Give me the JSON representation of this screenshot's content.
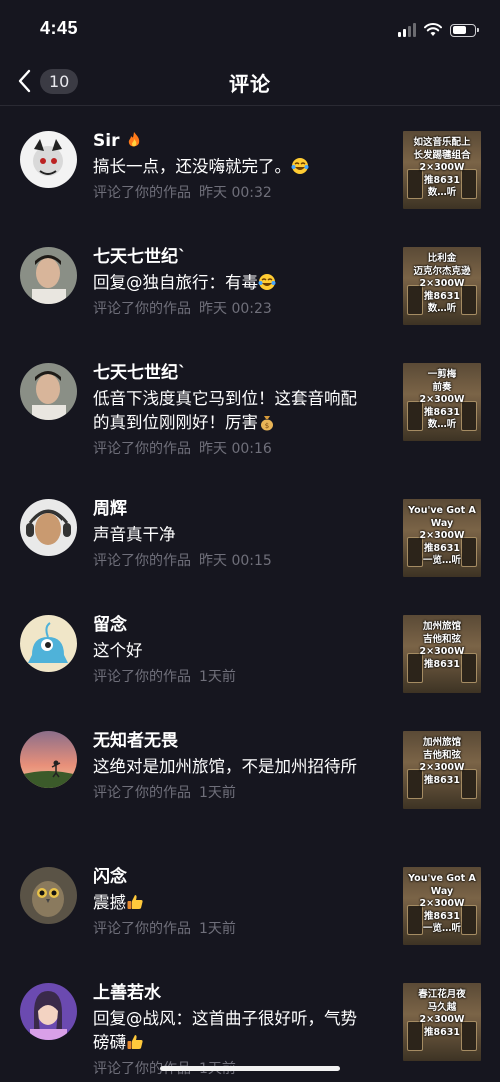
{
  "status": {
    "time": "4:45"
  },
  "nav": {
    "back_count": "10",
    "title": "评论"
  },
  "items": [
    {
      "name": "Sir",
      "name_emoji": "fire",
      "comment": "搞长一点，还没嗨就完了。",
      "comment_emoji": "laugh-tears",
      "action": "评论了你的作品",
      "when": "昨天 00:32",
      "thumb": "如这音乐配上\n长发踢毽组合\n2×300W\n推8631\n数…听"
    },
    {
      "name": "七天七世纪`",
      "name_emoji": "",
      "comment": "回复@独自旅行：有毒",
      "comment_emoji": "laugh-tears",
      "action": "评论了你的作品",
      "when": "昨天 00:23",
      "thumb": "比利金\n迈克尔杰克逊\n2×300W\n推8631\n数…听"
    },
    {
      "name": "七天七世纪`",
      "name_emoji": "",
      "comment": "低音下浅度真它马到位！这套音响配的真到位刚刚好！厉害",
      "comment_emoji": "money-bag",
      "action": "评论了你的作品",
      "when": "昨天 00:16",
      "thumb": "一剪梅\n前奏\n2×300W\n推8631\n数…听"
    },
    {
      "name": "周辉",
      "name_emoji": "",
      "comment": "声音真干净",
      "comment_emoji": "",
      "action": "评论了你的作品",
      "when": "昨天 00:15",
      "thumb": "You've Got A Way\n2×300W\n推8631\n一览…听"
    },
    {
      "name": "留念",
      "name_emoji": "",
      "comment": "这个好",
      "comment_emoji": "",
      "action": "评论了你的作品",
      "when": "1天前",
      "thumb": "加州旅馆\n吉他和弦\n2×300W\n推8631"
    },
    {
      "name": "无知者无畏",
      "name_emoji": "",
      "comment": "这绝对是加州旅馆，不是加州招待所",
      "comment_emoji": "",
      "action": "评论了你的作品",
      "when": "1天前",
      "thumb": "加州旅馆\n吉他和弦\n2×300W\n推8631"
    },
    {
      "name": "闪念",
      "name_emoji": "",
      "comment": "震撼",
      "comment_emoji": "thumbs-up",
      "action": "评论了你的作品",
      "when": "1天前",
      "thumb": "You've Got A Way\n2×300W\n推8631\n一览…听"
    },
    {
      "name": "上善若水",
      "name_emoji": "",
      "comment": "回复@战风：这首曲子很好听，气势磅礴",
      "comment_emoji": "thumbs-up",
      "action": "评论了你的作品",
      "when": "1天前",
      "thumb": "春江花月夜\n马久越\n2×300W\n推8631"
    }
  ]
}
